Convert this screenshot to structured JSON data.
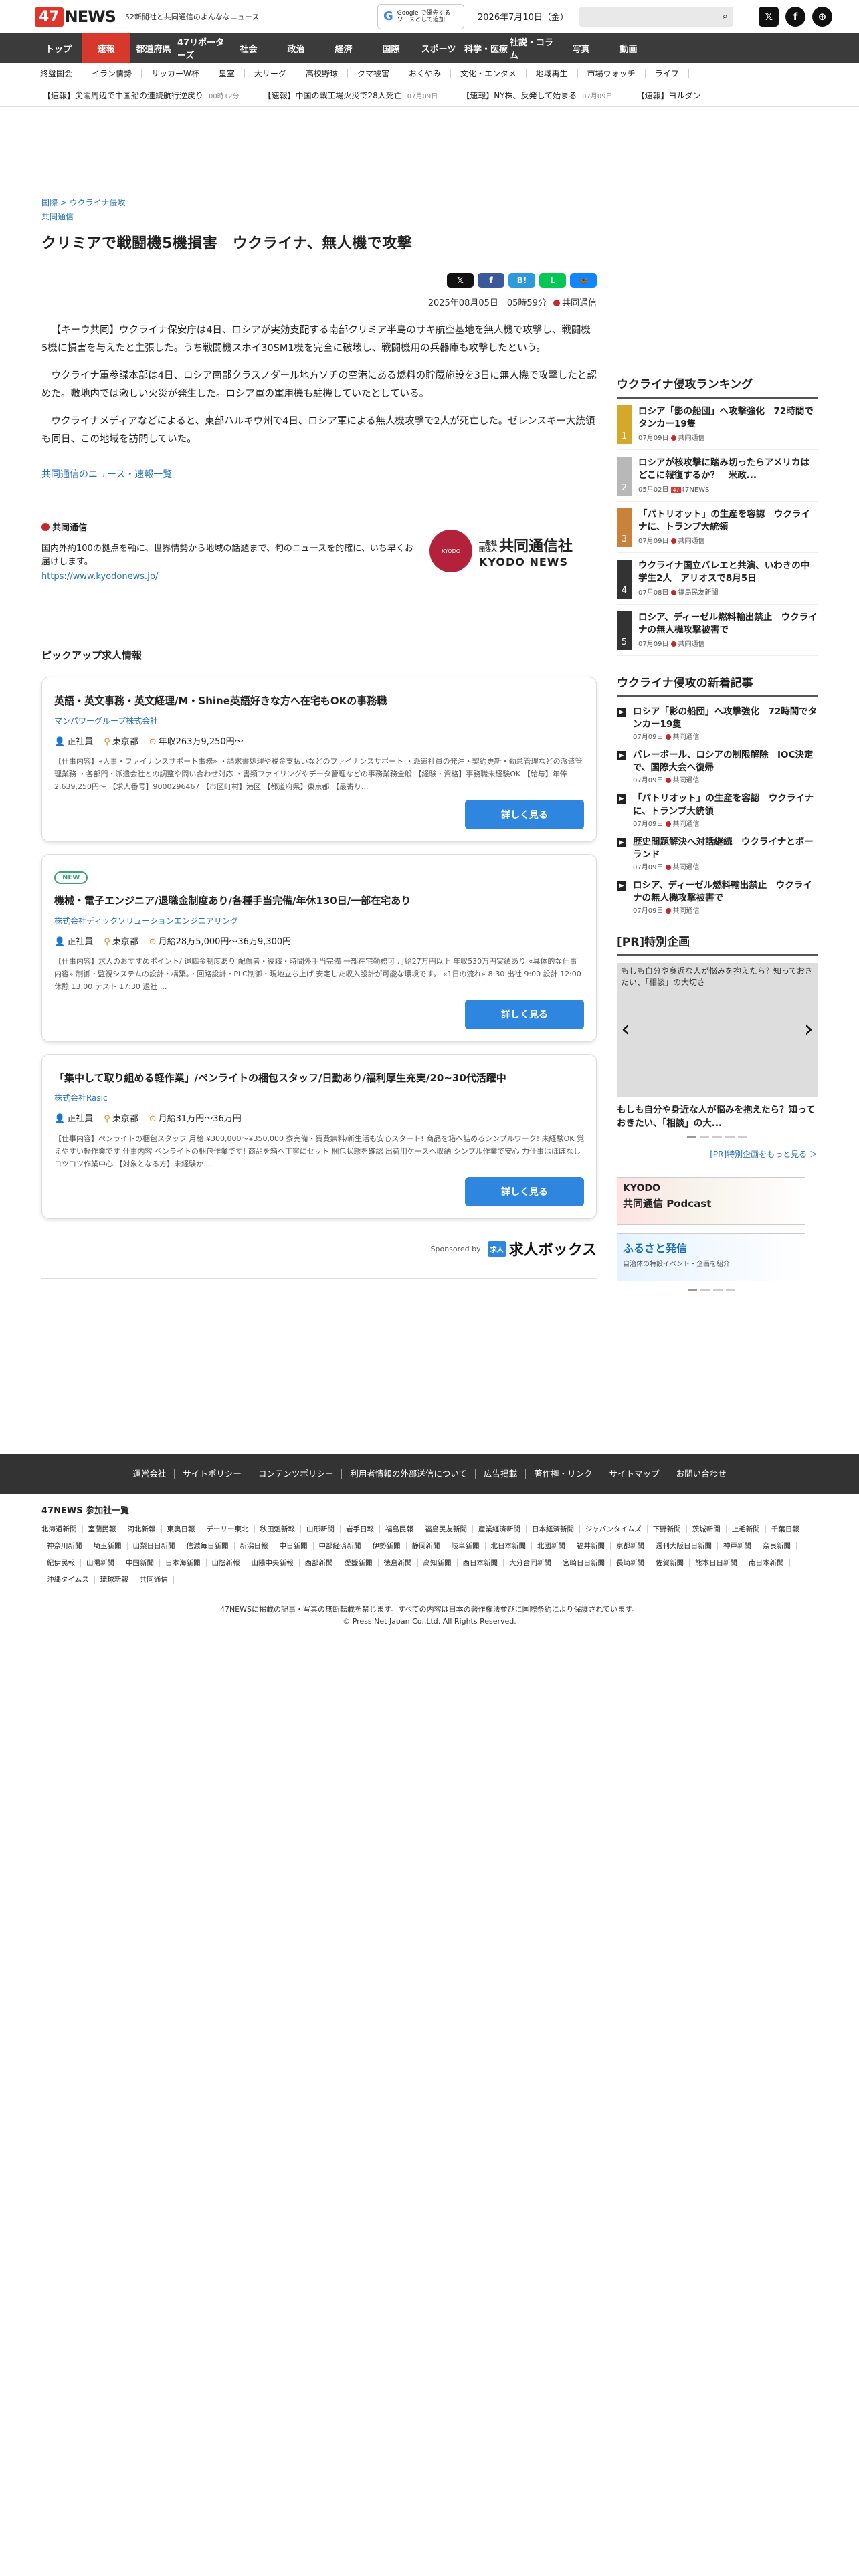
{
  "header": {
    "logo_num": "47",
    "logo_news": "NEWS",
    "tagline": "52新聞社と共同通信のよんななニュース",
    "google_btn_line1": "Google で優先する",
    "google_btn_line2": "ソースとして追加",
    "date": "2026年7月10日（金）",
    "social": [
      {
        "icon": "x-icon",
        "glyph": "𝕏"
      },
      {
        "icon": "facebook-icon",
        "glyph": "f"
      },
      {
        "icon": "globe-icon",
        "glyph": "⊕"
      }
    ]
  },
  "main_nav": [
    "トップ",
    "速報",
    "都道府県",
    "47リポーターズ",
    "社会",
    "政治",
    "経済",
    "国際",
    "スポーツ",
    "科学・医療",
    "社説・コラム",
    "写真",
    "動画"
  ],
  "main_nav_active": "速報",
  "sub_nav": [
    "終盤国会",
    "イラン情勢",
    "サッカーW杯",
    "皇室",
    "大リーグ",
    "高校野球",
    "クマ被害",
    "おくやみ",
    "文化・エンタメ",
    "地域再生",
    "市場ウォッチ",
    "ライフ"
  ],
  "breaking": [
    {
      "text": "【速報】尖閣周辺で中国船の連続航行逆戻り",
      "time": "00時12分"
    },
    {
      "text": "【速報】中国の戦工場火災で28人死亡",
      "time": "07月09日"
    },
    {
      "text": "【速報】NY株、反発して始まる",
      "time": "07月09日"
    },
    {
      "text": "【速報】ヨルダン",
      "time": ""
    }
  ],
  "article": {
    "breadcrumb_1": "国際",
    "breadcrumb_sep": ">",
    "breadcrumb_2": "ウクライナ侵攻",
    "source_link": "共同通信",
    "title": "クリミアで戦闘機5機損害　ウクライナ、無人機で攻撃",
    "share": [
      {
        "name": "share-x-button",
        "label": "𝕏",
        "color": "#111111"
      },
      {
        "name": "share-facebook-button",
        "label": "f",
        "color": "#3b5998"
      },
      {
        "name": "share-hatena-button",
        "label": "B!",
        "color": "#2d9ad9"
      },
      {
        "name": "share-line-button",
        "label": "L",
        "color": "#06c755"
      },
      {
        "name": "share-bluesky-button",
        "label": "🦋",
        "color": "#1185fe"
      }
    ],
    "date": "2025年08月05日　05時59分",
    "agency": "共同通信",
    "paragraphs": [
      "【キーウ共同】ウクライナ保安庁は4日、ロシアが実効支配する南部クリミア半島のサキ航空基地を無人機で攻撃し、戦闘機5機に損害を与えたと主張した。うち戦闘機スホイ30SM1機を完全に破壊し、戦闘機用の兵器庫も攻撃したという。",
      "ウクライナ軍参謀本部は4日、ロシア南部クラスノダール地方ソチの空港にある燃料の貯蔵施設を3日に無人機で攻撃したと認めた。敷地内では激しい火災が発生した。ロシア軍の軍用機も駐機していたとしている。",
      "ウクライナメディアなどによると、東部ハルキウ州で4日、ロシア軍による無人機攻撃で2人が死亡した。ゼレンスキー大統領も同日、この地域を訪問していた。"
    ],
    "more_link": "共同通信のニュース・速報一覧"
  },
  "kyodo": {
    "name": "共同通信",
    "desc": "国内外約100の拠点を軸に、世界情勢から地域の話題まで、旬のニュースを的確に、いち早くお届けします。",
    "url": "https://www.kyodonews.jp/",
    "logo_circle": "KYODO",
    "logo_pre": "一般社団法人",
    "logo_jp": "共同通信社",
    "logo_en": "KYODO NEWS"
  },
  "pickup": {
    "title": "ピックアップ求人情報",
    "detail_label": "詳しく見る",
    "jobs": [
      {
        "is_new": false,
        "title": "英語・英文事務・英文経理/M・Shine英語好きな方へ在宅もOKの事務職",
        "company": "マンパワーグループ株式会社",
        "type": "正社員",
        "location": "東京都",
        "salary": "年収263万9,250円〜",
        "desc": "【仕事内容】«人事・ファイナンスサポート事務» ・請求書処理や税金支払いなどのファイナンスサポート ・派遣社員の発注・契約更新・勤怠管理などの派遣管理業務 ・各部門・派遣会社との調整や問い合わせ対応 ・書類ファイリングやデータ管理などの事務業務全般 【経験・資格】事務職未経験OK 【給与】年俸 2,639,250円〜 【求人番号】9000296467 【市区町村】港区 【都道府県】東京都 【最寄り..."
      },
      {
        "is_new": true,
        "new_label": "NEW",
        "title": "機械・電子エンジニア/退職金制度あり/各種手当完備/年休130日/一部在宅あり",
        "company": "株式会社ディックソリューションエンジニアリング",
        "type": "正社員",
        "location": "東京都",
        "salary": "月給28万5,000円〜36万9,300円",
        "desc": "【仕事内容】求人のおすすめポイント/ 退職金制度あり 配偶者・役職・時間外手当完備 一部在宅勤務可 月給27万円以上 年収530万円実績あり «具体的な仕事内容» 制御・監視システムの設計・構築。・回路設計・PLC制御・現地立ち上げ 安定した収入設計が可能な環境です。 «1日の流れ» 8:30 出社 9:00 設計 12:00 休憩 13:00 テスト 17:30 退社 ..."
      },
      {
        "is_new": false,
        "title": "「集中して取り組める軽作業」/ペンライトの梱包スタッフ/日勤あり/福利厚生充実/20~30代活躍中",
        "company": "株式会社Rasic",
        "type": "正社員",
        "location": "東京都",
        "salary": "月給31万円〜36万円",
        "desc": "【仕事内容】ペンライトの梱包スタッフ 月給 ¥300,000〜¥350,000 寮完備・費費無料/新生活も安心スタート! 商品を箱へ詰めるシンプルワーク! 未経験OK 覚えやすい軽作業です 仕事内容 ペンライトの梱包作業です! 商品を箱へ丁寧にセット 梱包状態を確認 出荷用ケースへ収納 シンプル作業で安心 力仕事はほぼなし コツコツ作業中心 【対象となる方】未経験か..."
      }
    ],
    "sponsored_label": "Sponsored by",
    "sponsor_badge": "求人",
    "sponsor_name": "求人ボックス"
  },
  "sidebar": {
    "ranking_title": "ウクライナ侵攻ランキング",
    "ranking": [
      {
        "rank": "1",
        "title": "ロシア「影の船団」へ攻撃強化　72時間でタンカー19隻",
        "date": "07月09日",
        "src": "共同通信",
        "badge": ""
      },
      {
        "rank": "2",
        "title": "ロシアが核攻撃に踏み切ったらアメリカはどこに報復するか？　米政...",
        "date": "05月02日",
        "src": "47NEWS",
        "badge": "47"
      },
      {
        "rank": "3",
        "title": "「パトリオット」の生産を容認　ウクライナに、トランプ大統領",
        "date": "07月09日",
        "src": "共同通信",
        "badge": ""
      },
      {
        "rank": "4",
        "title": "ウクライナ国立バレエと共演、いわきの中学生2人　アリオスで8月5日",
        "date": "07月08日",
        "src": "福島民友新聞",
        "badge": ""
      },
      {
        "rank": "5",
        "title": "ロシア、ディーゼル燃料輸出禁止　ウクライナの無人機攻撃被害で",
        "date": "07月09日",
        "src": "共同通信",
        "badge": ""
      }
    ],
    "new_title": "ウクライナ侵攻の新着記事",
    "new_articles": [
      {
        "title": "ロシア「影の船団」へ攻撃強化　72時間でタンカー19隻",
        "date": "07月09日",
        "src": "共同通信"
      },
      {
        "title": "バレーボール、ロシアの制限解除　IOC決定で、国際大会へ復帰",
        "date": "07月09日",
        "src": "共同通信"
      },
      {
        "title": "「パトリオット」の生産を容認　ウクライナに、トランプ大統領",
        "date": "07月09日",
        "src": "共同通信"
      },
      {
        "title": "歴史問題解決へ対話継続　ウクライナとポーランド",
        "date": "07月09日",
        "src": "共同通信"
      },
      {
        "title": "ロシア、ディーゼル燃料輸出禁止　ウクライナの無人機攻撃被害で",
        "date": "07月09日",
        "src": "共同通信"
      }
    ],
    "pr_title": "[PR]特別企画",
    "pr_img_alt": "もしも自分や身近な人が悩みを抱えたら？知っておきたい、「相談」の大切さ",
    "pr_caption": "もしも自分や身近な人が悩みを抱えたら？知っておきたい、「相談」の大...",
    "pr_more": "[PR]特別企画をもっと見る ＞",
    "banner1_small": "KYODO",
    "banner1_main": "共同通信 Podcast",
    "banner2_main": "ふるさと発信",
    "banner2_sub": "自治体の特設イベント・企画を紹介"
  },
  "footer": {
    "nav": [
      "運営会社",
      "サイトポリシー",
      "コンテンツポリシー",
      "利用者情報の外部送信について",
      "広告掲載",
      "著作権・リンク",
      "サイトマップ",
      "お問い合わせ"
    ],
    "members_title": "47NEWS 参加社一覧",
    "members": [
      "北海道新聞",
      "室蘭民報",
      "河北新報",
      "東奥日報",
      "デーリー東北",
      "秋田魁新報",
      "山形新聞",
      "岩手日報",
      "福島民報",
      "福島民友新聞",
      "産業経済新聞",
      "日本経済新聞",
      "ジャパンタイムズ",
      "下野新聞",
      "茨城新聞",
      "上毛新聞",
      "千葉日報",
      "神奈川新聞",
      "埼玉新聞",
      "山梨日日新聞",
      "信濃毎日新聞",
      "新潟日報",
      "中日新聞",
      "中部経済新聞",
      "伊勢新聞",
      "静岡新聞",
      "岐阜新聞",
      "北日本新聞",
      "北國新聞",
      "福井新聞",
      "京都新聞",
      "週刊大阪日日新聞",
      "神戸新聞",
      "奈良新聞",
      "紀伊民報",
      "山陽新聞",
      "中国新聞",
      "日本海新聞",
      "山陰新報",
      "山陽中央新報",
      "西部新聞",
      "愛媛新聞",
      "徳島新聞",
      "高知新聞",
      "西日本新聞",
      "大分合同新聞",
      "宮崎日日新聞",
      "長崎新聞",
      "佐賀新聞",
      "熊本日日新聞",
      "南日本新聞",
      "沖縄タイムス",
      "琉球新報",
      "共同通信"
    ],
    "notice": "47NEWSに掲載の記事・写真の無断転載を禁じます。すべての内容は日本の著作権法並びに国際条約により保護されています。",
    "copyright": "© Press Net Japan Co.,Ltd. All Rights Reserved."
  }
}
